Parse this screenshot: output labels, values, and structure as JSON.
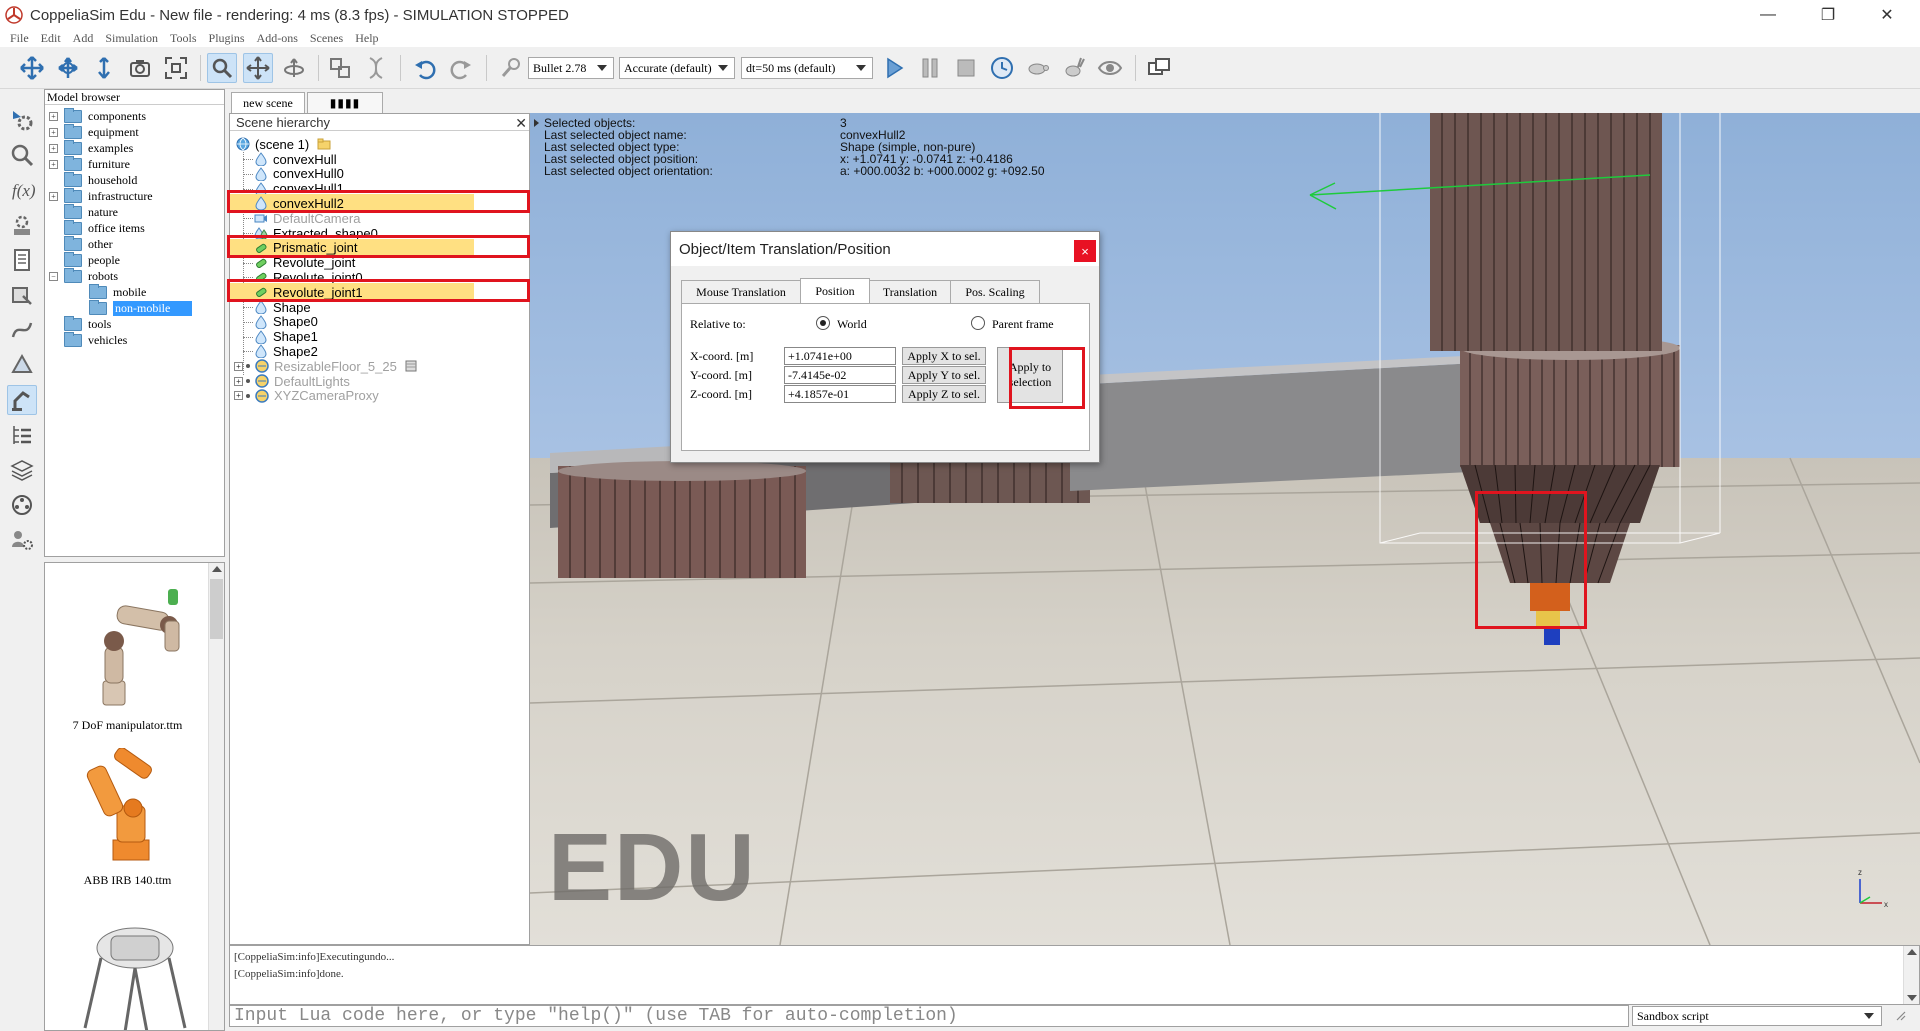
{
  "window": {
    "title": "CoppeliaSim Edu - New file - rendering: 4 ms (8.3 fps) - SIMULATION STOPPED",
    "minimize": "—",
    "restore": "❐",
    "close": "✕"
  },
  "menu": [
    "File",
    "Edit",
    "Add",
    "Simulation",
    "Tools",
    "Plugins",
    "Add-ons",
    "Scenes",
    "Help"
  ],
  "toolbar": {
    "engine": "Bullet 2.78",
    "accuracy": "Accurate (default)",
    "timestep": "dt=50 ms (default)"
  },
  "model_browser": {
    "header": "Model browser",
    "items": [
      {
        "label": "components",
        "expandable": true
      },
      {
        "label": "equipment",
        "expandable": true
      },
      {
        "label": "examples",
        "expandable": true
      },
      {
        "label": "furniture",
        "expandable": true
      },
      {
        "label": "household",
        "expandable": false
      },
      {
        "label": "infrastructure",
        "expandable": true
      },
      {
        "label": "nature",
        "expandable": false
      },
      {
        "label": "office items",
        "expandable": false
      },
      {
        "label": "other",
        "expandable": false
      },
      {
        "label": "people",
        "expandable": false
      },
      {
        "label": "robots",
        "expandable": true
      },
      {
        "label": "mobile",
        "expandable": false
      },
      {
        "label": "non-mobile",
        "expandable": false
      },
      {
        "label": "tools",
        "expandable": false
      },
      {
        "label": "vehicles",
        "expandable": false
      }
    ],
    "thumbnails": [
      "7 DoF manipulator.ttm",
      "ABB IRB 140.ttm"
    ]
  },
  "scene_tabs": {
    "active": "new scene",
    "other": "▮▮▮▮"
  },
  "hierarchy": {
    "header": "Scene hierarchy",
    "close": "✕",
    "root": "(scene 1)",
    "items": [
      {
        "label": "convexHull",
        "type": "shape",
        "highlighted": false,
        "dim": false
      },
      {
        "label": "convexHull0",
        "type": "shape",
        "highlighted": false,
        "dim": false
      },
      {
        "label": "convexHull1",
        "type": "shape",
        "highlighted": false,
        "dim": false
      },
      {
        "label": "convexHull2",
        "type": "shape",
        "highlighted": true,
        "dim": false
      },
      {
        "label": "DefaultCamera",
        "type": "camera",
        "highlighted": false,
        "dim": true
      },
      {
        "label": "Extracted_shape0",
        "type": "shape-multi",
        "highlighted": false,
        "dim": false
      },
      {
        "label": "Prismatic_joint",
        "type": "joint",
        "highlighted": true,
        "dim": false
      },
      {
        "label": "Revolute_joint",
        "type": "joint",
        "highlighted": false,
        "dim": false
      },
      {
        "label": "Revolute_joint0",
        "type": "joint",
        "highlighted": false,
        "dim": false
      },
      {
        "label": "Revolute_joint1",
        "type": "joint",
        "highlighted": true,
        "dim": false
      },
      {
        "label": "Shape",
        "type": "shape",
        "highlighted": false,
        "dim": false
      },
      {
        "label": "Shape0",
        "type": "shape",
        "highlighted": false,
        "dim": false
      },
      {
        "label": "Shape1",
        "type": "shape",
        "highlighted": false,
        "dim": false
      },
      {
        "label": "Shape2",
        "type": "shape",
        "highlighted": false,
        "dim": false
      },
      {
        "label": "ResizableFloor_5_25",
        "type": "model",
        "highlighted": false,
        "dim": true
      },
      {
        "label": "DefaultLights",
        "type": "model",
        "highlighted": false,
        "dim": true
      },
      {
        "label": "XYZCameraProxy",
        "type": "model",
        "highlighted": false,
        "dim": true
      }
    ]
  },
  "viewport_info": [
    {
      "label": "Selected objects:",
      "value": "3"
    },
    {
      "label": "Last selected object name:",
      "value": "convexHull2"
    },
    {
      "label": "Last selected object type:",
      "value": "Shape (simple, non-pure)"
    },
    {
      "label": "Last selected object position:",
      "value": "x: +1.0741    y: -0.0741    z: +0.4186"
    },
    {
      "label": "Last selected object orientation:",
      "value": "a: +000.0032    b: +000.0002    g: +092.50"
    }
  ],
  "watermark": "EDU",
  "dialog": {
    "title": "Object/Item Translation/Position",
    "close": "×",
    "tabs": [
      "Mouse Translation",
      "Position",
      "Translation",
      "Pos. Scaling"
    ],
    "active_tab": "Position",
    "relative_to_label": "Relative to:",
    "world_label": "World",
    "parent_label": "Parent frame",
    "relative_to": "World",
    "x_label": "X-coord. [m]",
    "y_label": "Y-coord. [m]",
    "z_label": "Z-coord. [m]",
    "x_value": "+1.0741e+00",
    "y_value": "-7.4145e-02",
    "z_value": "+4.1857e-01",
    "apply_x": "Apply X to sel.",
    "apply_y": "Apply Y to sel.",
    "apply_z": "Apply Z to sel.",
    "apply_sel_line1": "Apply to",
    "apply_sel_line2": "selection"
  },
  "console": {
    "lines": [
      "[CoppeliaSim:info]Executingundo...",
      "[CoppeliaSim:info]done."
    ]
  },
  "lua_input": {
    "placeholder": "Input Lua code here, or type \"help()\" (use TAB for auto-completion)"
  },
  "script_selector": "Sandbox script",
  "colors": {
    "highlight_box": "#e0141e",
    "selection_row": "#ffe082",
    "selected_folder": "#3399ff"
  }
}
